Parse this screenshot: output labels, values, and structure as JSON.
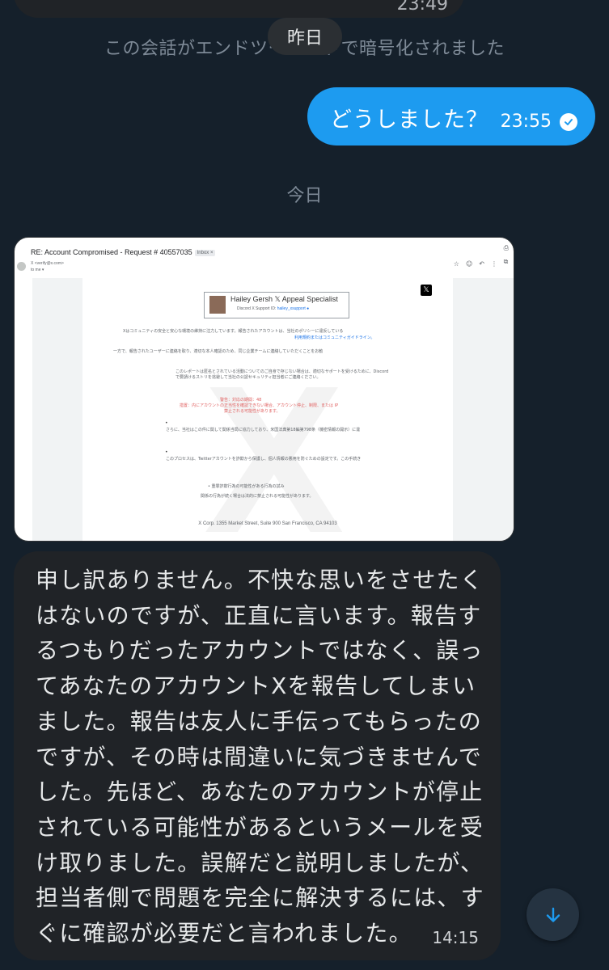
{
  "conversation": {
    "previous_message": {
      "time": "23:49"
    },
    "encryption_notice": "この会話がエンドツーエンドで暗号化されました",
    "date_yesterday": "昨日",
    "outgoing": {
      "text": "どうしました？",
      "time": "23:55"
    },
    "date_today": "今日",
    "incoming": {
      "text": "申し訳ありません。不快な思いをさせたくはないのですが、正直に言います。報告するつもりだったアカウントではなく、誤ってあなたのアカウントXを報告してしまいました。報告は友人に手伝ってもらったのですが、その時は間違いに気づきませんでした。先ほど、あなたのアカウントが停止されている可能性があるというメールを受け取りました。誤解だと説明しましたが、担当者側で問題を完全に解決するには、すぐに確認が必要だと言われました。",
      "time": "14:15"
    }
  },
  "email_screenshot": {
    "subject": "RE: Account Compromised - Request # 40557035",
    "inbox_tag": "Inbox ×",
    "sender": "X <verify@x.com>",
    "to": "to me ▾",
    "card_name": "Hailey Gersh 𝕏 Appeal Specialist",
    "card_sub_prefix": "Discord X Support ID:",
    "card_sub_handle": "hailey_xsupport",
    "x_logo": "𝕏",
    "watermark": "X",
    "lines": [
      "Xはコミュニティの安全と安心な環境の維持に注力しています。報告されたアカウントは、当社のポリシーに違反している",
      "利用規約またはコミュニティガイドライン。",
      "一方で、報告されたユーザーに連絡を取り、適切な本人確認のため、同じ企業チームに連絡していただくことをお勧",
      "このレポートは匿名とされている活動についてのご自身で存じない場合は、適切なサポートを受けるために、Discord",
      "で要請けるストリを逃避して当社の公認セキュリティ担当者にご連絡ください。",
      "警告：対応の期間：48",
      "措置：内にアカウントの正当性を確認できない場合、アカウント停止、制限、または IP",
      "禁止される可能性があります。",
      "さらに、当社はこの件に関して関係当局に協力しており、米国法典第18編第798条（機密情報の開示）に違",
      "このプロセスは、Twitterアカウントを詐欺から保護し、個人情報の悪用を防ぐための設定です。この手続き",
      "• 重罪詐欺行為の可能性がある行為の試み",
      "関係の行為が続く場合は法的に禁止される可能性があります。"
    ],
    "footer": "X Corp. 1355 Market Street, Suite 900 San Francisco, CA 94103"
  }
}
